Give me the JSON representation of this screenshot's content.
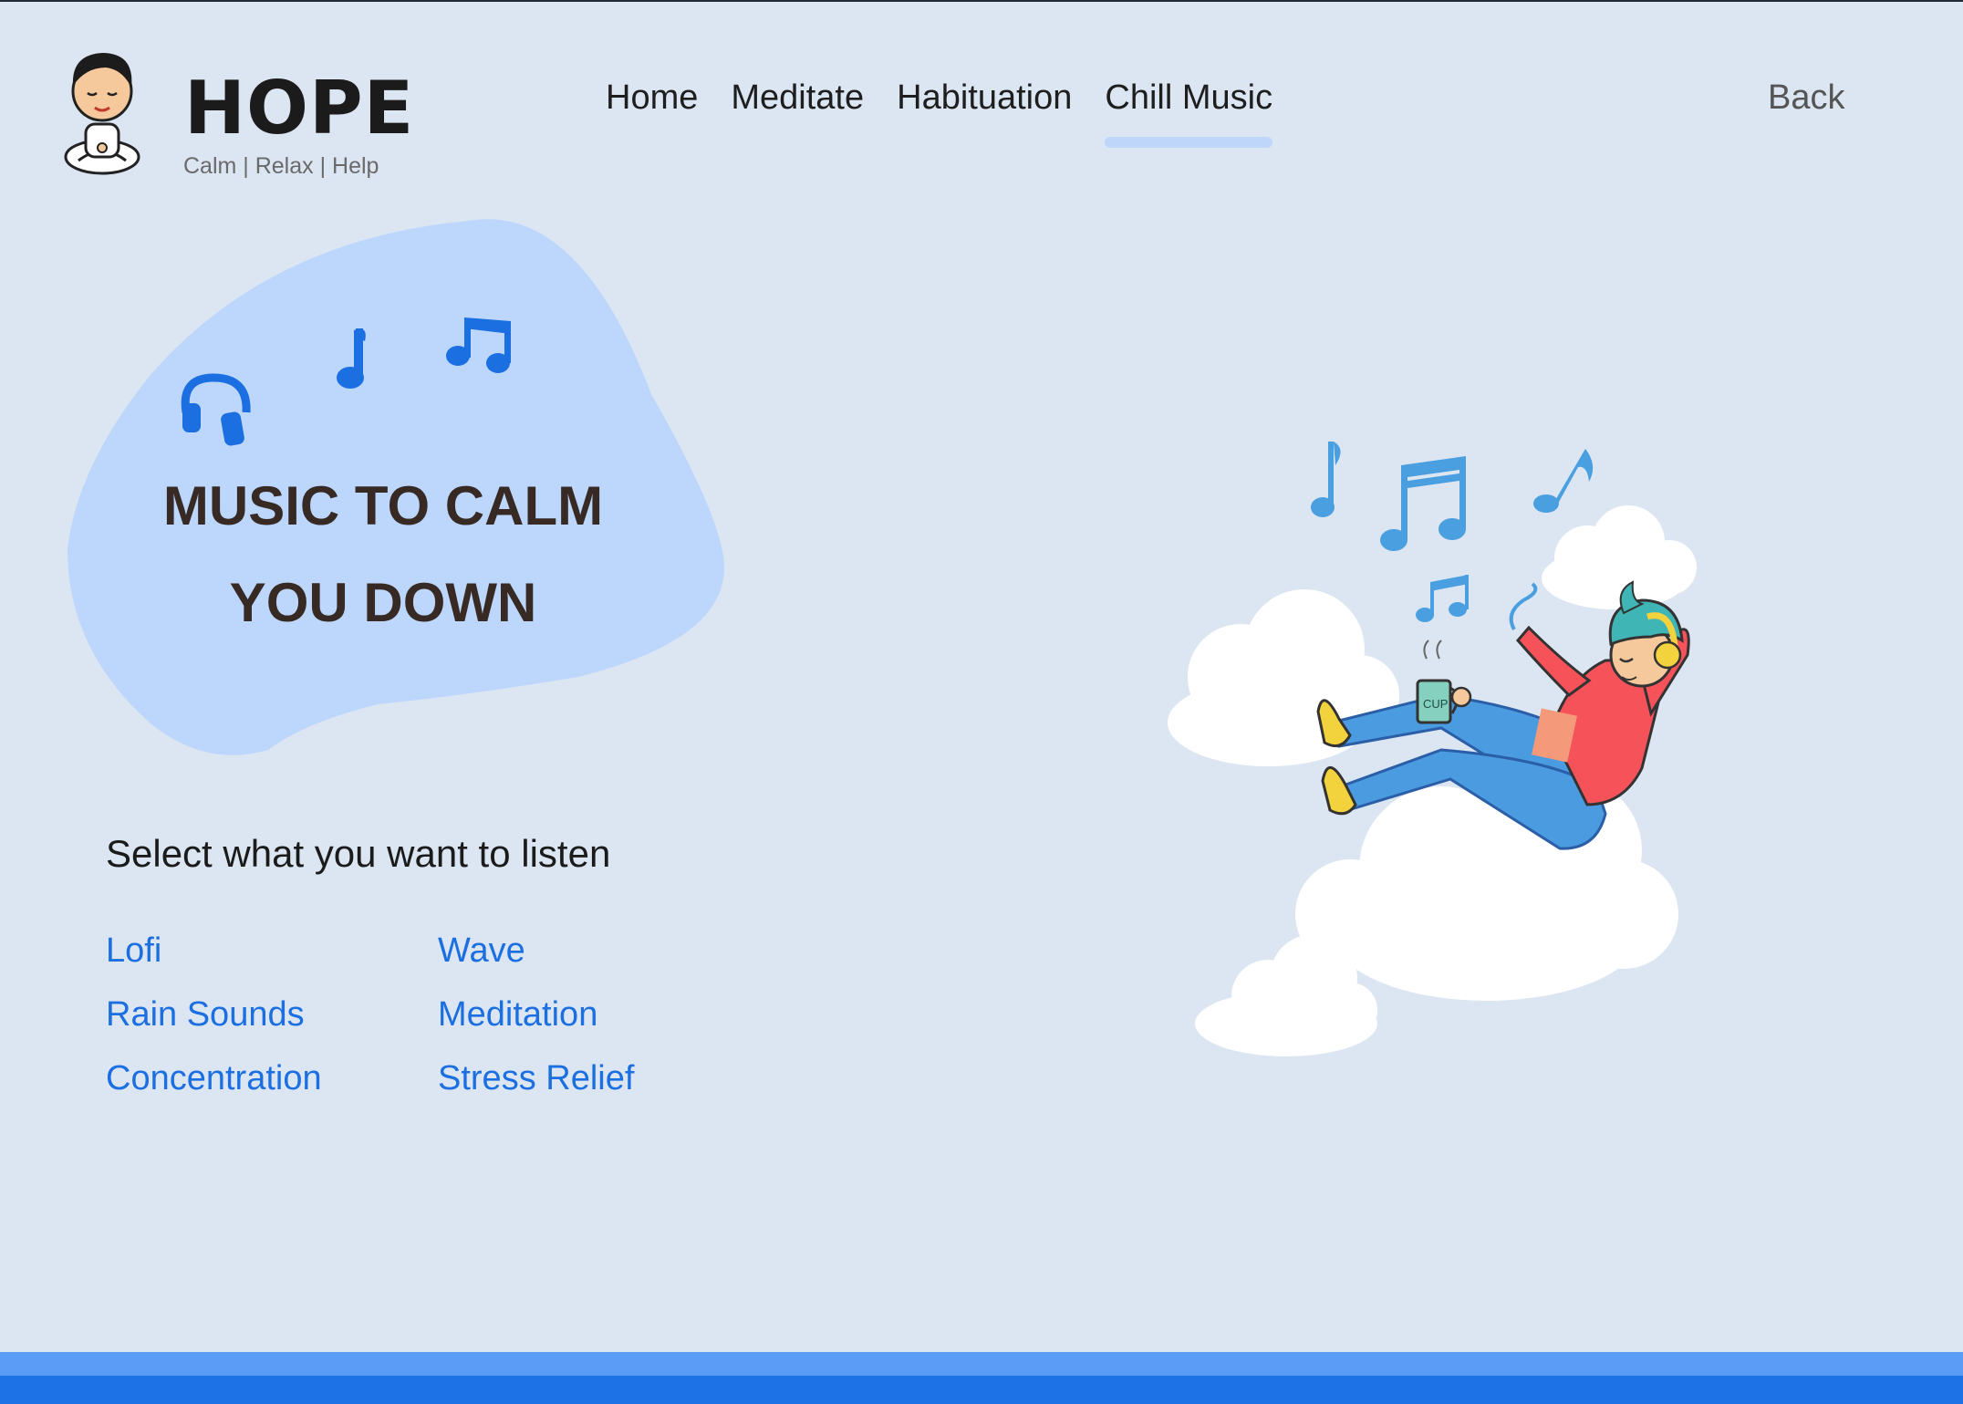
{
  "brand": {
    "title": "HOPE",
    "tagline": "Calm | Relax | Help"
  },
  "nav": {
    "items": [
      {
        "label": "Home",
        "active": false
      },
      {
        "label": "Meditate",
        "active": false
      },
      {
        "label": "Habituation",
        "active": false
      },
      {
        "label": "Chill Music",
        "active": true
      }
    ],
    "back_label": "Back"
  },
  "hero": {
    "title_line1": "MUSIC TO CALM",
    "title_line2": "YOU DOWN",
    "icons": [
      "headphones-icon",
      "music-note-icon",
      "beamed-notes-icon"
    ]
  },
  "selection": {
    "heading": "Select what you want to listen",
    "options": [
      "Lofi",
      "Wave",
      "Rain Sounds",
      "Meditation",
      "Concentration",
      "Stress Relief"
    ]
  },
  "illustration": {
    "mug_text": "CUP"
  },
  "colors": {
    "background": "#dce6f2",
    "blob": "#bdd7fc",
    "accent": "#1b6fe0",
    "nav_underline": "#bfd6fb",
    "footer_light": "#5b9cf6",
    "footer_dark": "#1d72e5"
  }
}
